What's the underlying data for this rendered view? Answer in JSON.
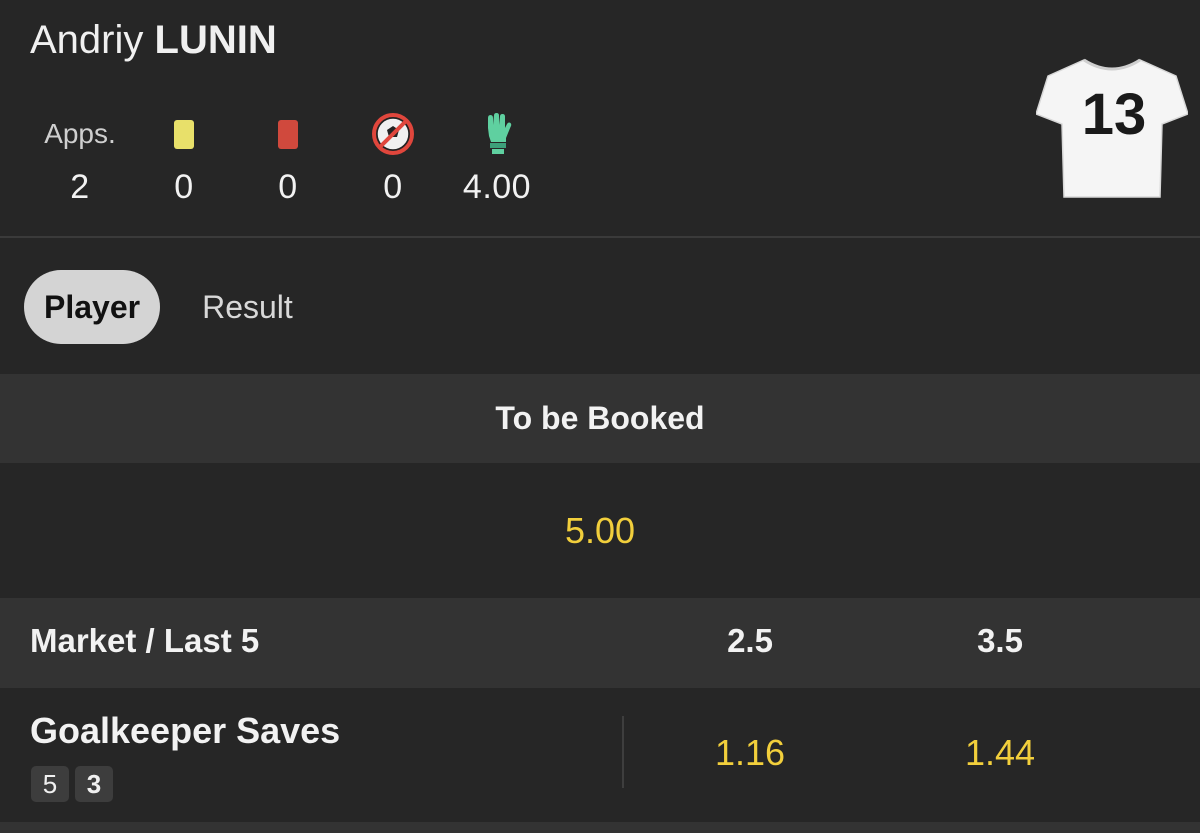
{
  "player": {
    "first_name": "Andriy",
    "last_name": "LUNIN",
    "shirt_number": "13"
  },
  "stats": [
    {
      "label": "Apps.",
      "icon": "appearances",
      "value": "2"
    },
    {
      "icon": "yellow-card-icon",
      "value": "0"
    },
    {
      "icon": "red-card-icon",
      "value": "0"
    },
    {
      "icon": "own-goal-icon",
      "value": "0"
    },
    {
      "icon": "goalkeeper-glove-icon",
      "value": "4.00"
    }
  ],
  "tabs": [
    {
      "label": "Player",
      "active": true
    },
    {
      "label": "Result",
      "active": false
    }
  ],
  "booked": {
    "title": "To be Booked",
    "odds": "5.00"
  },
  "market": {
    "header": "Market / Last 5",
    "columns": [
      "2.5",
      "3.5"
    ],
    "rows": [
      {
        "name": "Goalkeeper Saves",
        "last5": [
          "5",
          "3"
        ],
        "odds": [
          "1.16",
          "1.44"
        ]
      }
    ]
  },
  "colors": {
    "odds": "#f2cf3c",
    "background": "#262626",
    "section": "#333333"
  }
}
